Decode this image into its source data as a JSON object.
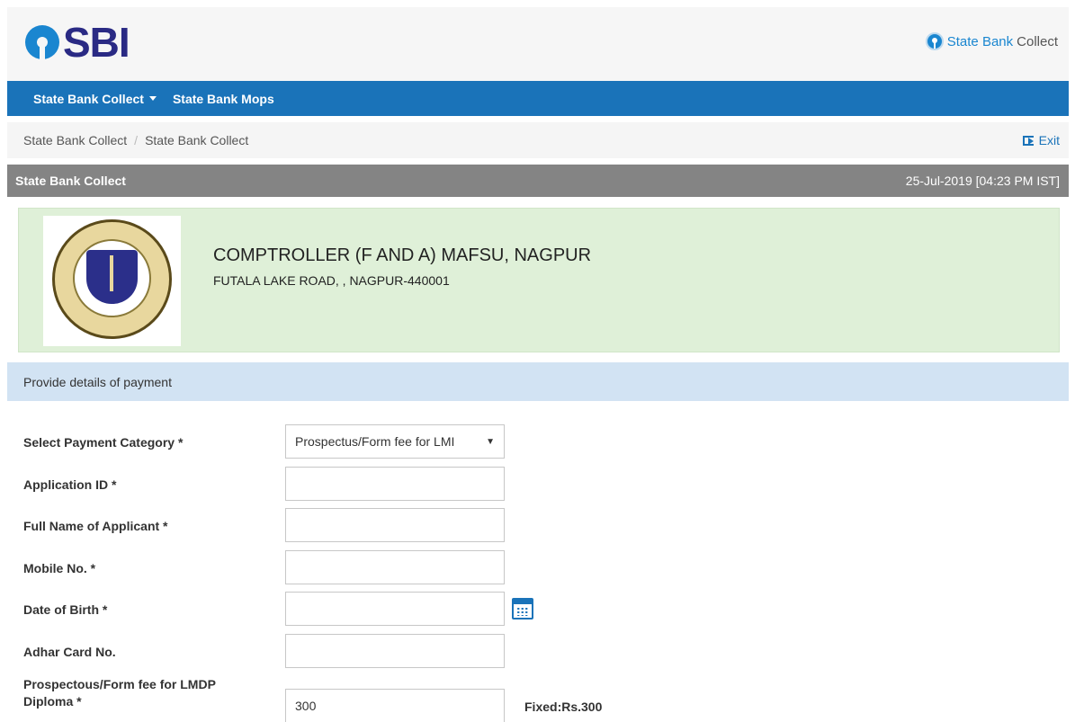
{
  "header": {
    "logo_text": "SBI",
    "brand_state_bank": "State Bank",
    "brand_collect": "Collect"
  },
  "navbar": {
    "items": [
      {
        "label": "State Bank Collect"
      },
      {
        "label": "State Bank Mops"
      }
    ]
  },
  "breadcrumb": {
    "items": [
      "State Bank Collect",
      "State Bank Collect"
    ],
    "separator": "/",
    "exit_label": "Exit"
  },
  "section": {
    "title": "State Bank Collect",
    "datetime": "25-Jul-2019 [04:23 PM IST]"
  },
  "merchant": {
    "name": "COMPTROLLER (F AND A) MAFSU, NAGPUR",
    "address": "FUTALA LAKE ROAD, , NAGPUR-440001"
  },
  "provide": {
    "label": "Provide details of payment"
  },
  "form": {
    "category_label": "Select Payment Category *",
    "category_value": "Prospectus/Form fee for LMI",
    "application_id_label": "Application ID *",
    "application_id_value": "",
    "full_name_label": "Full Name of Applicant *",
    "full_name_value": "",
    "mobile_label": "Mobile No. *",
    "mobile_value": "",
    "dob_label": "Date of Birth *",
    "dob_value": "",
    "adhar_label": "Adhar Card No.",
    "adhar_value": "",
    "fee_label_line1": "Prospectous/Form fee for LMDP",
    "fee_label_line2": "Diploma *",
    "fee_value": "300",
    "fee_note": "Fixed:Rs.300"
  },
  "colors": {
    "navbar": "#1a73b9",
    "section_bar": "#848484",
    "merchant_bg": "#dff0d8",
    "provide_bg": "#d2e3f3",
    "sbi_blue": "#1a86d0",
    "sbi_text": "#2a2a84"
  }
}
